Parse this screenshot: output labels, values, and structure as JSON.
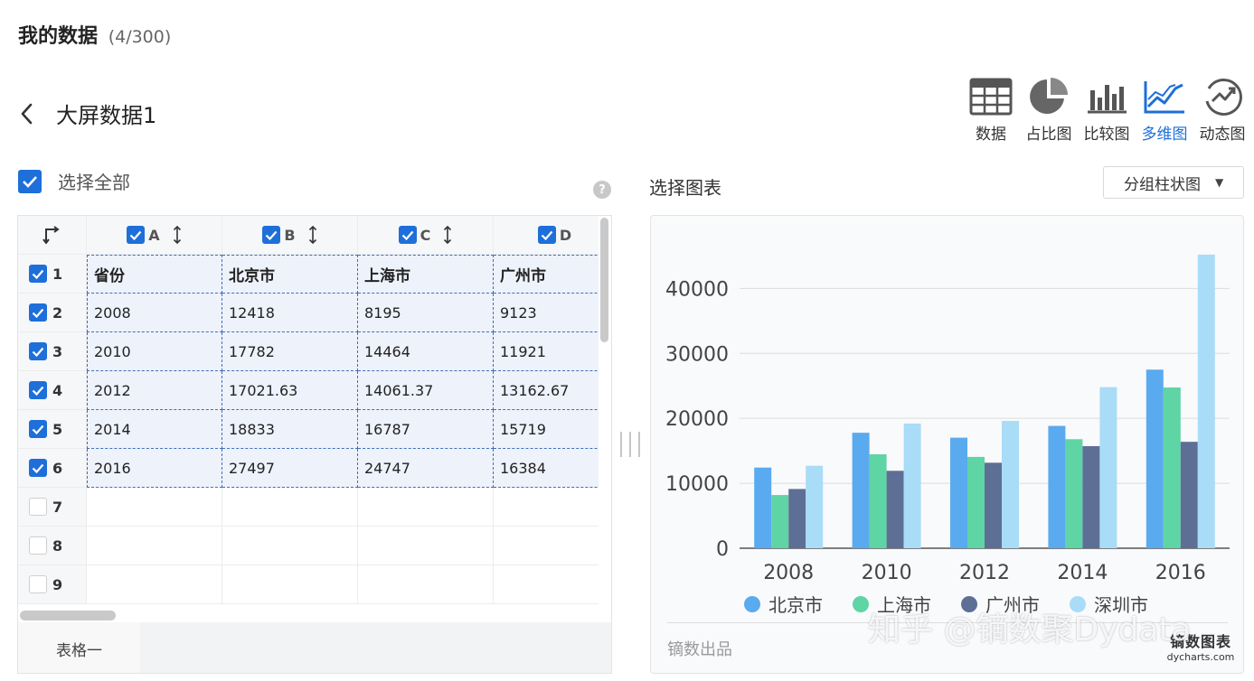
{
  "header": {
    "title": "我的数据",
    "count": "(4/300)"
  },
  "dataset": {
    "title": "大屏数据1"
  },
  "view_switch": [
    {
      "label": "数据",
      "icon": "table-icon",
      "active": false
    },
    {
      "label": "占比图",
      "icon": "pie-chart-icon",
      "active": false
    },
    {
      "label": "比较图",
      "icon": "bar-chart-icon",
      "active": false
    },
    {
      "label": "多维图",
      "icon": "line-chart-icon",
      "active": true
    },
    {
      "label": "动态图",
      "icon": "dynamic-chart-icon",
      "active": false
    }
  ],
  "select_all": {
    "label": "选择全部",
    "checked": true
  },
  "table": {
    "columns": [
      "A",
      "B",
      "C",
      "D"
    ],
    "row_numbers": [
      "1",
      "2",
      "3",
      "4",
      "5",
      "6",
      "7",
      "8",
      "9"
    ],
    "rows": [
      [
        "省份",
        "北京市",
        "上海市",
        "广州市"
      ],
      [
        "2008",
        "12418",
        "8195",
        "9123"
      ],
      [
        "2010",
        "17782",
        "14464",
        "11921"
      ],
      [
        "2012",
        "17021.63",
        "14061.37",
        "13162.67"
      ],
      [
        "2014",
        "18833",
        "16787",
        "15719"
      ],
      [
        "2016",
        "27497",
        "24747",
        "16384"
      ],
      [
        "",
        "",
        "",
        ""
      ],
      [
        "",
        "",
        "",
        ""
      ],
      [
        "",
        "",
        "",
        ""
      ]
    ],
    "checked_rows": 6
  },
  "sheet_tab": "表格一",
  "chart_panel": {
    "label": "选择图表",
    "chart_type": "分组柱状图",
    "source": "镝数出品",
    "brand_cn": "镝数图表",
    "brand_url": "dycharts.com"
  },
  "watermark": "知乎 @镝数聚Dydata",
  "colors": {
    "accent": "#1e6fd9",
    "beijing": "#5aaaf0",
    "shanghai": "#5fd4a4",
    "guangzhou": "#5e6f96",
    "shenzhen": "#a9dcf7"
  },
  "chart_data": {
    "type": "bar",
    "categories": [
      "2008",
      "2010",
      "2012",
      "2014",
      "2016"
    ],
    "series": [
      {
        "name": "北京市",
        "values": [
          12418,
          17782,
          17021.63,
          18833,
          27497
        ]
      },
      {
        "name": "上海市",
        "values": [
          8195,
          14464,
          14061.37,
          16787,
          24747
        ]
      },
      {
        "name": "广州市",
        "values": [
          9123,
          11921,
          13162.67,
          15719,
          16384
        ]
      },
      {
        "name": "深圳市",
        "values": [
          12700,
          19200,
          19600,
          24800,
          45200
        ]
      }
    ],
    "yticks": [
      "0",
      "10000",
      "20000",
      "30000",
      "40000"
    ],
    "ylim": [
      0,
      47000
    ],
    "grid": true,
    "legend": "bottom"
  }
}
